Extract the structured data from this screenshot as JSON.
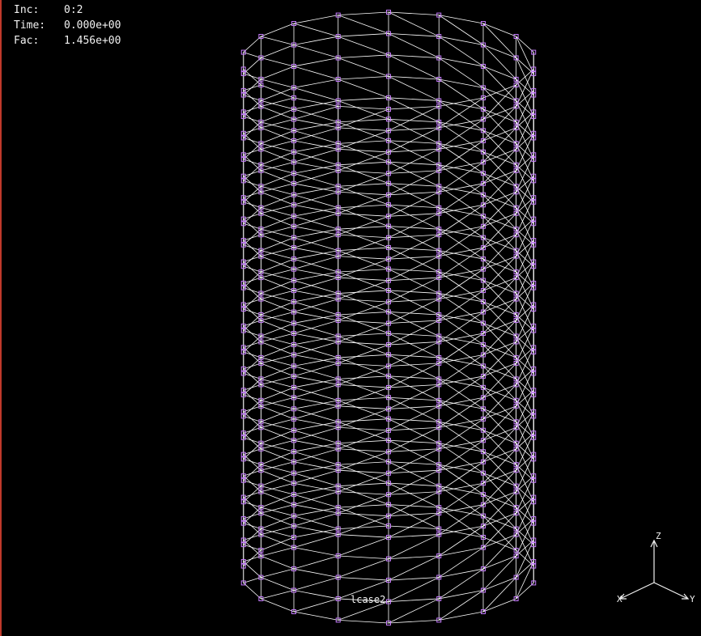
{
  "info": {
    "rows": [
      {
        "label": "Inc:",
        "value": "0:2"
      },
      {
        "label": "Time:",
        "value": "0.000e+00"
      },
      {
        "label": "Fac:",
        "value": "1.456e+00"
      }
    ]
  },
  "case_label": "lcase2",
  "axes": {
    "z_label": "Z",
    "x_label": "X",
    "y_label": "Y"
  },
  "colors": {
    "background": "#000000",
    "mesh_line": "#ffffff",
    "node_marker": "#c77dff",
    "text": "#f2f2f2",
    "border": "#c0392b"
  }
}
